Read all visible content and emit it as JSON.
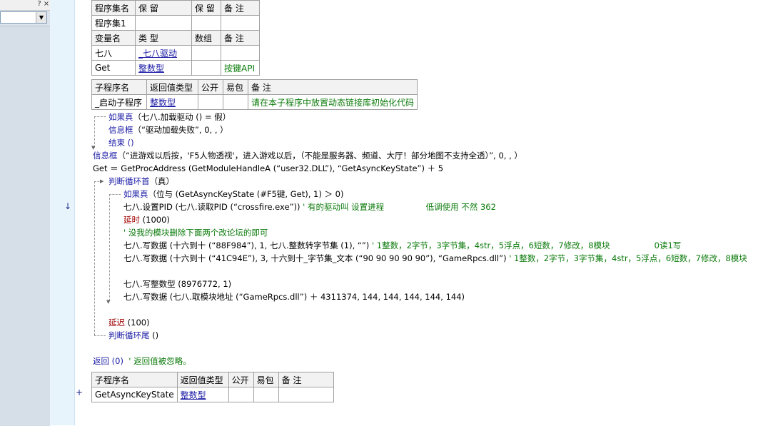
{
  "left_panel": {
    "help_glyph": "?",
    "close_glyph": "×",
    "combo_arrow": "▼"
  },
  "gutter": {
    "down_arrow": "↓",
    "plus": "+"
  },
  "assembly_table": {
    "headers": [
      "程序集名",
      "保 留",
      "保 留",
      "备 注"
    ],
    "row": [
      "程序集1",
      "",
      "",
      ""
    ]
  },
  "var_table": {
    "headers": [
      "变量名",
      "类 型",
      "数组",
      "备 注"
    ],
    "rows": [
      [
        "七八",
        "_七八驱动",
        "",
        ""
      ],
      [
        "Get",
        "整数型",
        "",
        "按键API"
      ]
    ]
  },
  "sub1_table": {
    "headers": [
      "子程序名",
      "返回值类型",
      "公开",
      "易包",
      "备 注"
    ],
    "row": [
      "_启动子程序",
      "整数型",
      "",
      "",
      "请在本子程序中放置动态链接库初始化代码"
    ]
  },
  "code": {
    "l1_kw": "如果真",
    "l1_rest": "（七八.加载驱动 () = 假）",
    "l2_kw": "信息框",
    "l2_rest": "（“驱动加载失败”, 0, , ）",
    "l3": "结束 ()",
    "l4_kw": "信息框",
    "l4_rest": "（“进游戏以后按，'F5人物透视'，进入游戏以后，（不能是服务器、频道、大厅！部分地图不支持全透）”, 0, , ）",
    "l5": "Get ＝ GetProcAddress (GetModuleHandleA (“user32.DLL”), “GetAsyncKeyState”) ＋ 5",
    "l6_kw": "判断循环首",
    "l6_rest": "（真）",
    "l7_kw": "如果真",
    "l7_rest": "（位与 (GetAsyncKeyState (#F5键, Get), 1) ＞ 0)",
    "l8_code": "七八.设置PID (七八.读取PID (“crossfire.exe”))",
    "l8_comment": " ' 有的驱动叫 设置进程                低调使用 不然 362",
    "l9_kw": "延时",
    "l9_rest": " (1000)",
    "l10": "' 没我的模块删除下面两个改论坛的即可",
    "l11_code": "七八.写数据 (十六到十 (“88F984”), 1, 七八.整数转字节集 (1), “”)",
    "l11_comment": " ' 1整数，2字节，3字节集，4str，5浮点，6短数，7修改，8模块                 0读1写",
    "l12_code": "七八.写数据 (十六到十 (“41C94E”), 3, 十六到十_字节集_文本 (“90 90 90 90 90”), “GameRpcs.dll”)",
    "l12_comment": " ' 1整数，2字节，3字节集，4str，5浮点，6短数，7修改，8模块",
    "l13": "七八.写整数型 (8976772, 1)",
    "l14": "七八.写数据 (七八.取模块地址 (“GameRpcs.dll”) ＋ 4311374, 144, 144, 144, 144, 144)",
    "l15_kw": "延迟",
    "l15_rest": " (100)",
    "l16_kw": "判断循环尾",
    "l16_rest": " ()",
    "l17_code": "返回 (0)",
    "l17_comment": "  ' 返回值被忽略。"
  },
  "sub2_table": {
    "headers": [
      "子程序名",
      "返回值类型",
      "公开",
      "易包",
      "备 注"
    ],
    "row": [
      "GetAsyncKeyState",
      "整数型",
      "",
      "",
      ""
    ]
  }
}
